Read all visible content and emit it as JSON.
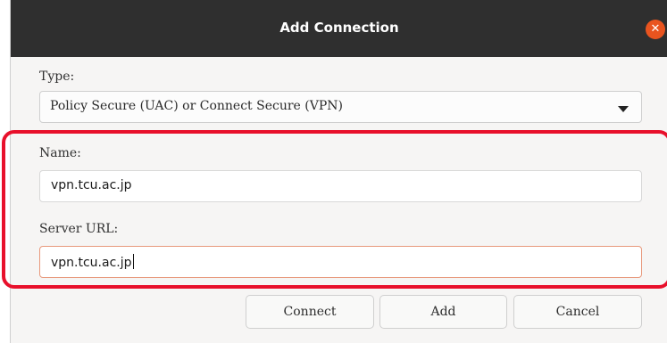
{
  "dialog": {
    "title": "Add Connection",
    "close_icon": "close-icon"
  },
  "type": {
    "label": "Type:",
    "selected": "Policy Secure (UAC) or Connect Secure (VPN)"
  },
  "name": {
    "label": "Name:",
    "value": "vpn.tcu.ac.jp"
  },
  "server_url": {
    "label": "Server URL:",
    "value": "vpn.tcu.ac.jp"
  },
  "buttons": {
    "connect": "Connect",
    "add": "Add",
    "cancel": "Cancel"
  },
  "colors": {
    "titlebar": "#2f2f2f",
    "close": "#e9541f",
    "highlight": "#e8102b",
    "focus_border": "#e8997c"
  }
}
